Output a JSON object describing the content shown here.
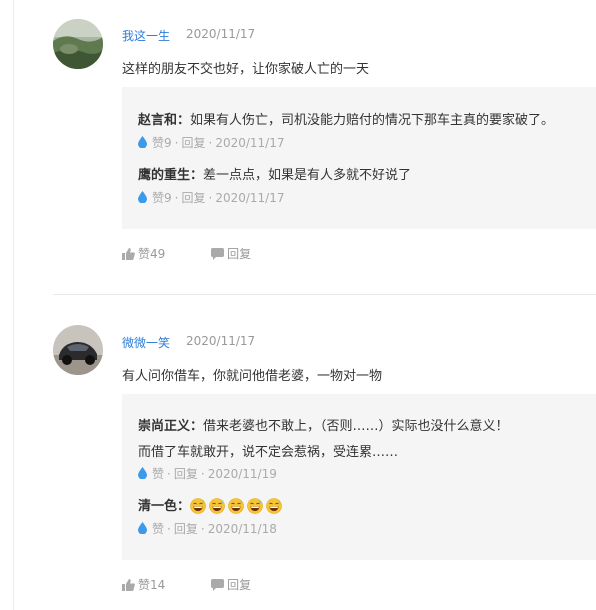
{
  "comments": [
    {
      "username": "我这一生",
      "time": "2020/11/17",
      "text": "这样的朋友不交也好，让你家破人亡的一天",
      "replies": [
        {
          "author": "赵言和",
          "colon": "：",
          "text": "如果有人伤亡，司机没能力赔付的情况下那车主真的要家破了。",
          "likes": "赞9",
          "reply_label": "回复",
          "sep": "·",
          "time": "2020/11/17"
        },
        {
          "author": "鹰的重生",
          "colon": "：",
          "text": "差一点点，如果是有人多就不好说了",
          "likes": "赞9",
          "reply_label": "回复",
          "sep": "·",
          "time": "2020/11/17"
        }
      ],
      "likes": "赞49",
      "reply_label": "回复"
    },
    {
      "username": "微微一笑",
      "time": "2020/11/17",
      "text": "有人问你借车，你就问他借老婆，一物对一物",
      "replies": [
        {
          "author": "崇尚正义",
          "colon": "：",
          "text": "借来老婆也不敢上，（否则……）实际也没什么意义！",
          "text2": "而借了车就敢开，说不定会惹祸，受连累……",
          "likes": "赞",
          "reply_label": "回复",
          "sep": "·",
          "time": "2020/11/19"
        },
        {
          "author": "清一色",
          "colon": "：",
          "emoji_icon": "grinning-sweat-emoji",
          "emoji_count": 5,
          "likes": "赞",
          "reply_label": "回复",
          "sep": "·",
          "time": "2020/11/18"
        }
      ],
      "likes": "赞14",
      "reply_label": "回复"
    }
  ],
  "icons": {
    "like": "thumbs-up-icon",
    "comment": "speech-bubble-icon",
    "reply_like": "water-drop-icon"
  },
  "colors": {
    "username": "#2f7ed8",
    "meta": "#999999",
    "drop": "#3d9ae8",
    "reply_bg": "#f5f5f5"
  }
}
